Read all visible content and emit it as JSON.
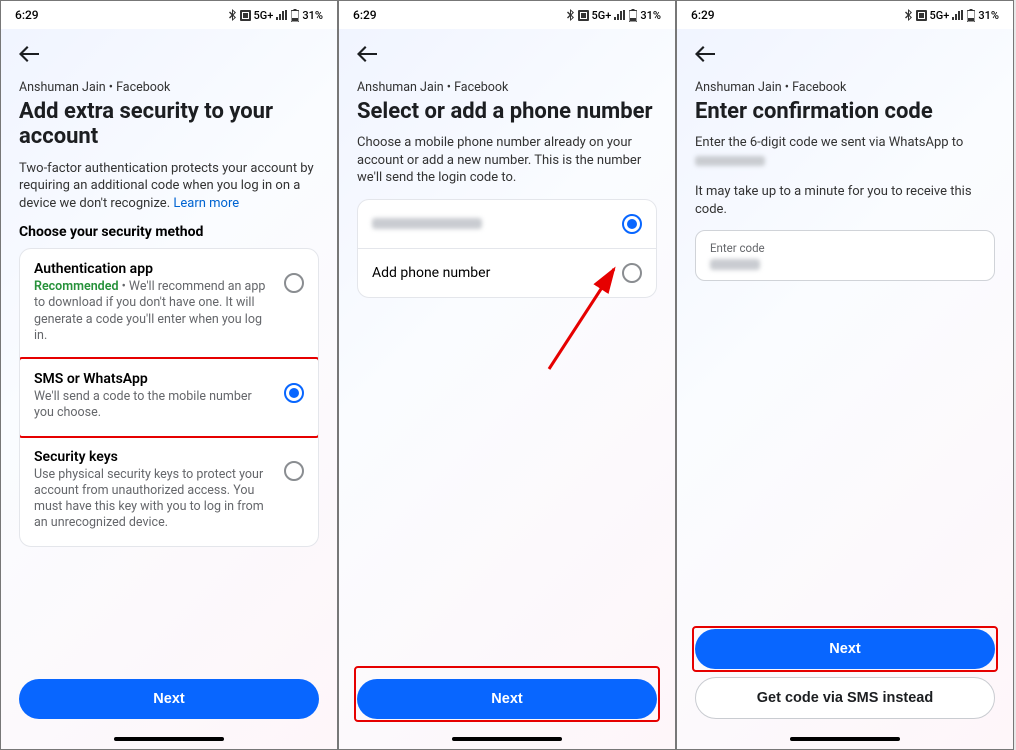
{
  "status": {
    "time": "6:29",
    "network": "5G+",
    "battery": "31%"
  },
  "screen1": {
    "breadcrumb": "Anshuman Jain • Facebook",
    "title": "Add extra security to your account",
    "desc_part1": "Two-factor authentication protects your account by requiring an additional code when you log in on a device we don't recognize. ",
    "learn_more": "Learn more",
    "section_heading": "Choose your security method",
    "opt1_title": "Authentication app",
    "opt1_recommended": "Recommended",
    "opt1_desc": " • We'll recommend an app to download if you don't have one. It will generate a code you'll enter when you log in.",
    "opt2_title": "SMS or WhatsApp",
    "opt2_desc": "We'll send a code to the mobile number you choose.",
    "opt3_title": "Security keys",
    "opt3_desc": "Use physical security keys to protect your account from unauthorized access. You must have this key with you to log in from an unrecognized device.",
    "next_label": "Next"
  },
  "screen2": {
    "breadcrumb": "Anshuman Jain • Facebook",
    "title": "Select or add a phone number",
    "desc": "Choose a mobile phone number already on your account or add a new number. This is the number we'll send the login code to.",
    "add_phone": "Add phone number",
    "next_label": "Next"
  },
  "screen3": {
    "breadcrumb": "Anshuman Jain • Facebook",
    "title": "Enter confirmation code",
    "desc1": "Enter the 6-digit code we sent via WhatsApp to",
    "desc2": "It may take up to a minute for you to receive this code.",
    "input_label": "Enter code",
    "next_label": "Next",
    "sms_label": "Get code via SMS instead"
  }
}
